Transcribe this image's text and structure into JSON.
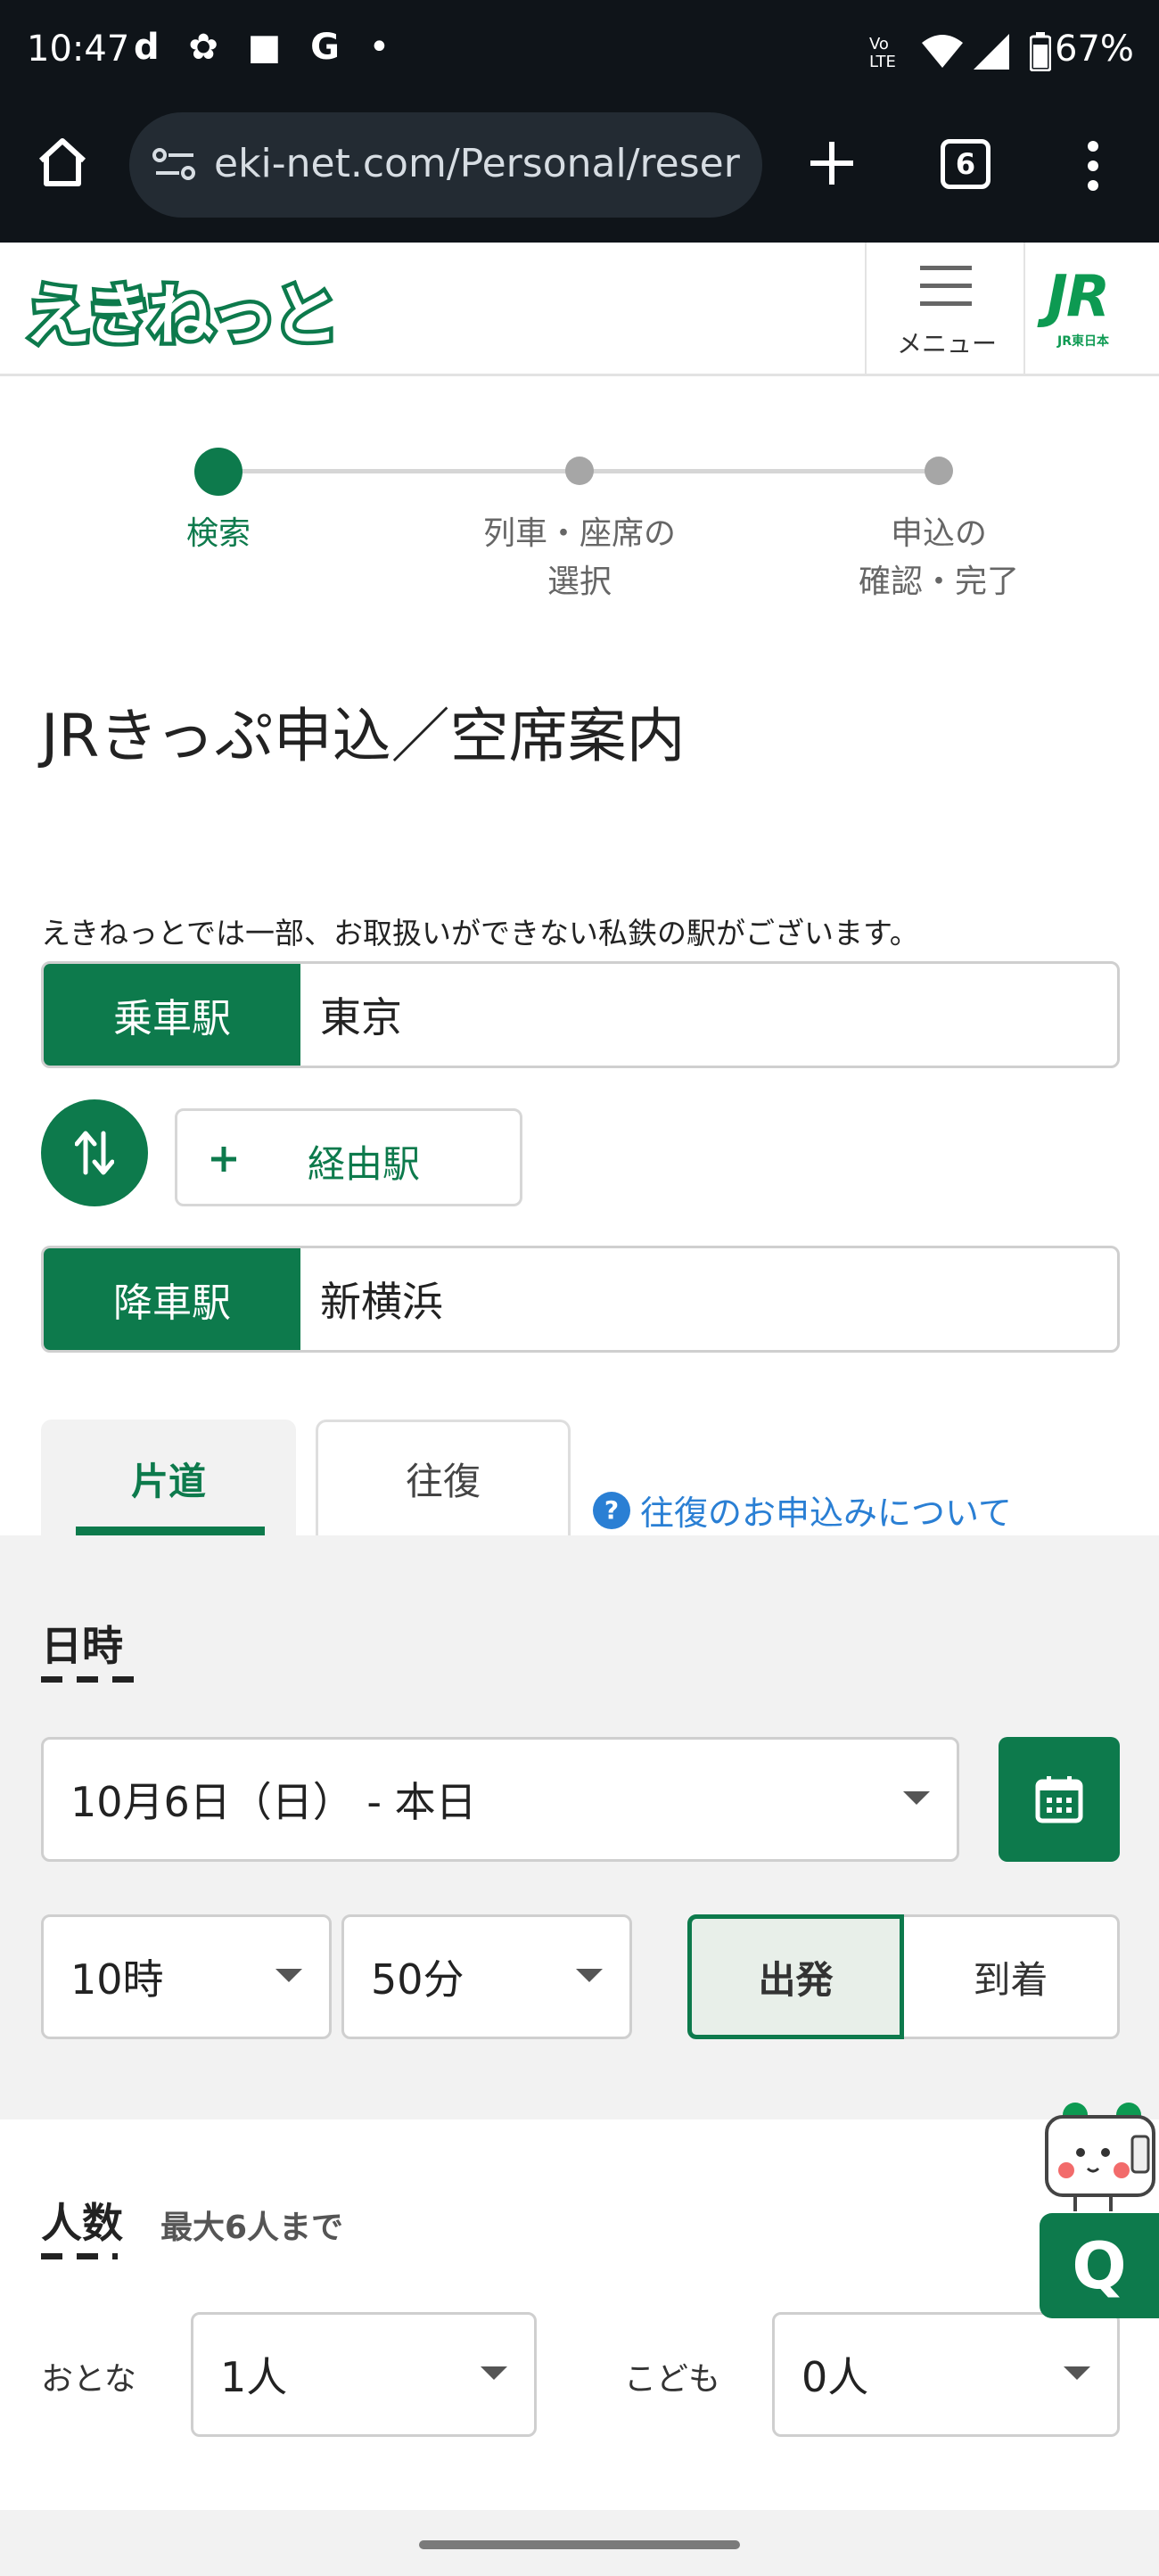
{
  "status_bar": {
    "time": "10:47",
    "left_icons": [
      "d",
      "✿",
      "■",
      "G",
      "•"
    ],
    "network": "Vo LTE",
    "battery": "67%"
  },
  "browser": {
    "url": "eki-net.com/Personal/reser",
    "tab_count": "6"
  },
  "header": {
    "logo": "えきねっと",
    "menu_label": "メニュー",
    "jr_logo": "JR",
    "jr_sub": "JR東日本"
  },
  "stepper": {
    "steps": [
      {
        "label": "検索",
        "active": true
      },
      {
        "label": "列車・座席の\n選択",
        "active": false
      },
      {
        "label": "申込の\n確認・完了",
        "active": false
      }
    ]
  },
  "page_title": "JRきっぷ申込／空席案内",
  "notice": "えきねっとでは一部、お取扱いができない私鉄の駅がございます。",
  "stations": {
    "departure_label": "乗車駅",
    "departure_value": "東京",
    "via_label": "経由駅",
    "arrival_label": "降車駅",
    "arrival_value": "新横浜"
  },
  "trip_tabs": {
    "one_way": "片道",
    "round_trip": "往復",
    "help_link": "往復のお申込みについて"
  },
  "datetime": {
    "section_title": "日時",
    "date_value": "10月6日（日） - 本日",
    "hour_value": "10時",
    "minute_value": "50分",
    "depart_label": "出発",
    "arrive_label": "到着"
  },
  "people": {
    "section_title": "人数",
    "note": "最大6人まで",
    "adult_label": "おとな",
    "adult_value": "1人",
    "child_label": "こども",
    "child_value": "0人"
  },
  "chat_button": "Q",
  "colors": {
    "brand_green": "#0d7a4c",
    "link_blue": "#2a7fd4",
    "system_dark": "#0f1419"
  }
}
